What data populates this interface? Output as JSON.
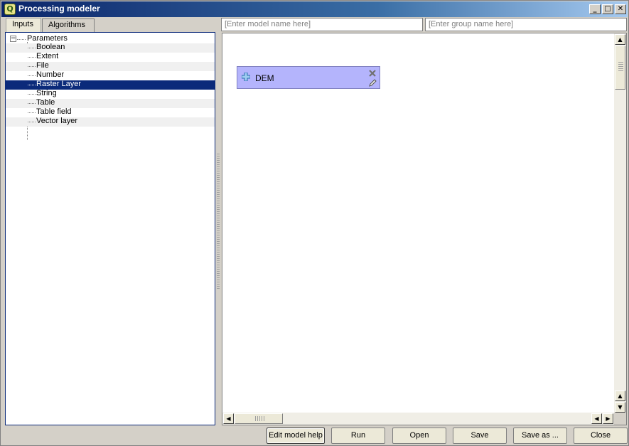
{
  "window": {
    "title": "Processing modeler",
    "icon_letter": "Q",
    "controls": {
      "minimize": "_",
      "maximize": "□",
      "close": "✕"
    }
  },
  "tabs": [
    {
      "label": "Inputs",
      "active": true
    },
    {
      "label": "Algorithms",
      "active": false
    }
  ],
  "tree": {
    "root": {
      "label": "Parameters",
      "expander": "−"
    },
    "items": [
      {
        "label": "Boolean"
      },
      {
        "label": "Extent"
      },
      {
        "label": "File"
      },
      {
        "label": "Number"
      },
      {
        "label": "Raster Layer",
        "selected": true
      },
      {
        "label": "String"
      },
      {
        "label": "Table"
      },
      {
        "label": "Table field"
      },
      {
        "label": "Vector layer"
      }
    ]
  },
  "model_name_input": {
    "value": "",
    "placeholder": "[Enter model name here]"
  },
  "group_name_input": {
    "value": "",
    "placeholder": "[Enter group name here]"
  },
  "canvas": {
    "nodes": [
      {
        "label": "DEM",
        "icon": "plus-icon",
        "actions": [
          "delete-icon",
          "edit-icon"
        ]
      }
    ],
    "scrollbars": {
      "up": "▲",
      "down": "▼",
      "left": "◀",
      "right": "▶"
    }
  },
  "buttons": {
    "help": "Edit model help",
    "run": "Run",
    "open": "Open",
    "save": "Save",
    "save_as": "Save as ...",
    "close": "Close"
  },
  "colors": {
    "title_bar": "#0a246a",
    "selection": "#0b2a7a",
    "node_fill": "#b4b4fc"
  }
}
